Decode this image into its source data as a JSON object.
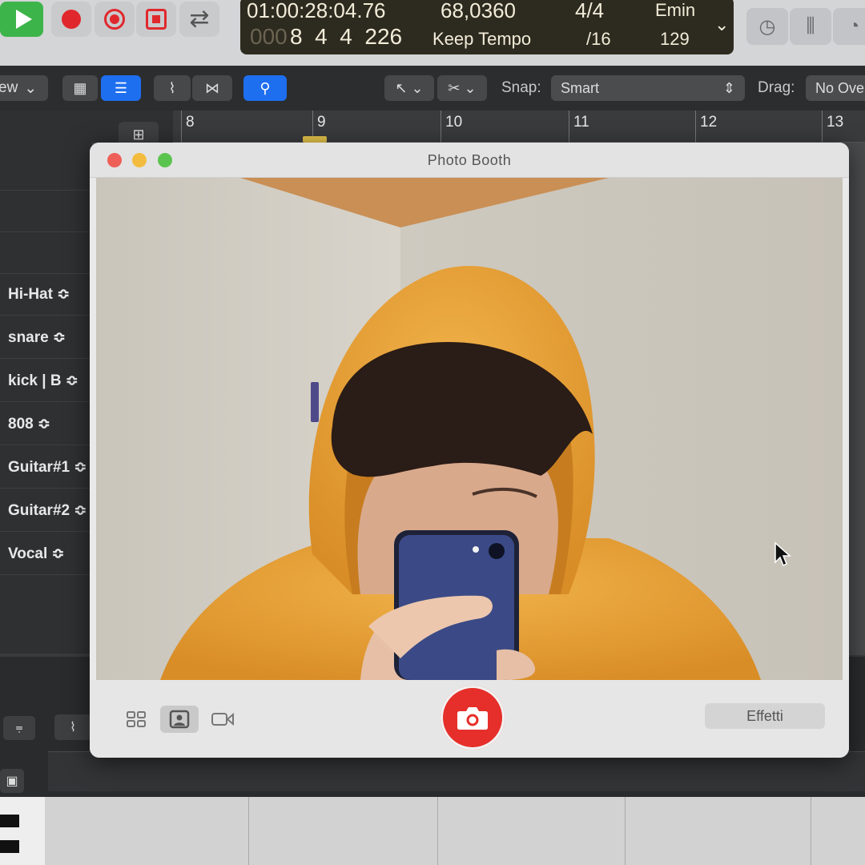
{
  "transport": {
    "time": "01:00:28:04.76",
    "bars": "8  4  4  226",
    "bars_faded": "000",
    "tempo": "68,0360",
    "tempo_mode": "Keep Tempo",
    "signature": "4/4",
    "division": "/16",
    "key": "Emin",
    "key_value": "129"
  },
  "toolbar": {
    "view_label": "ew",
    "snap_label": "Snap:",
    "snap_value": "Smart",
    "drag_label": "Drag:",
    "drag_value": "No Ove"
  },
  "ruler": {
    "bars": [
      "8",
      "9",
      "10",
      "11",
      "12",
      "13"
    ]
  },
  "tracks": [
    {
      "name": "Hi-Hat ≎"
    },
    {
      "name": "snare ≎"
    },
    {
      "name": "kick | B ≎"
    },
    {
      "name": "808 ≎"
    },
    {
      "name": "Guitar#1 ≎"
    },
    {
      "name": "Guitar#2 ≎"
    },
    {
      "name": "Vocal ≎"
    }
  ],
  "photo_booth": {
    "title": "Photo Booth",
    "effects_label": "Effetti",
    "capture_icon": "camera-icon",
    "mode_icons": [
      "grid-icon",
      "single-photo-icon",
      "video-icon"
    ]
  },
  "colors": {
    "play": "#3db44a",
    "record": "#e0282c",
    "accent_blue": "#1e6ff0",
    "capture": "#e62f2a",
    "hoodie": "#e9a43a"
  }
}
